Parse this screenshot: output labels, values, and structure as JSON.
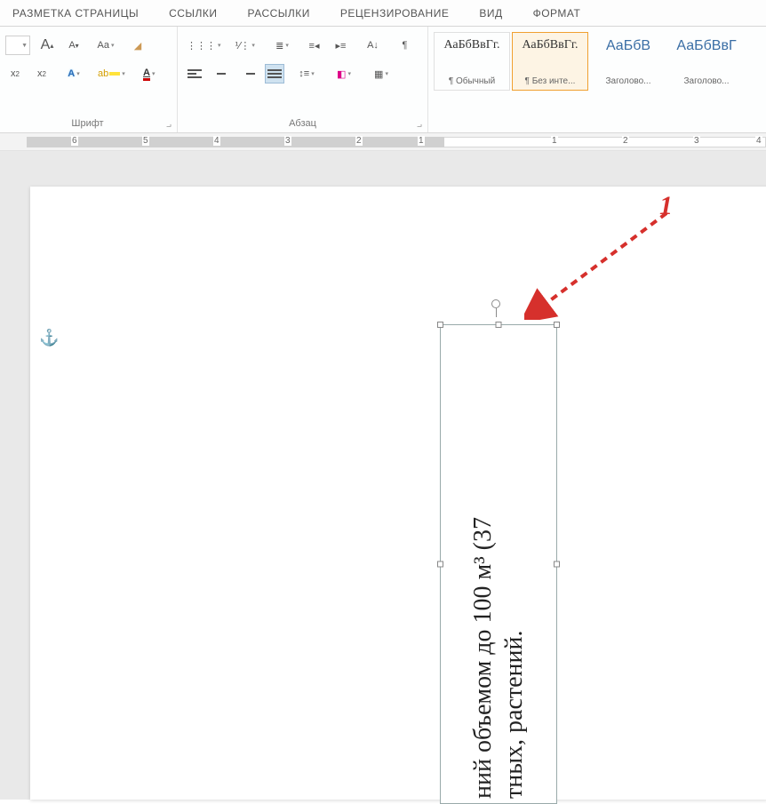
{
  "tabs": {
    "page_layout": "РАЗМЕТКА СТРАНИЦЫ",
    "references": "ССЫЛКИ",
    "mailings": "РАССЫЛКИ",
    "review": "РЕЦЕНЗИРОВАНИЕ",
    "view": "ВИД",
    "format": "ФОРМАТ"
  },
  "ribbon": {
    "font": {
      "label": "Шрифт",
      "grow": "A",
      "shrink": "A",
      "case": "Aa",
      "clear": "⌫",
      "sub": "x",
      "sup": "x",
      "text_effects": "A",
      "highlight": "✎",
      "font_color": "A"
    },
    "paragraph": {
      "label": "Абзац"
    },
    "styles": {
      "preview_text": "АаБбВвГг.",
      "preview_text2": "АаБбВ",
      "preview_text3": "АаБбВвГ",
      "normal": "¶ Обычный",
      "no_spacing": "¶ Без инте...",
      "heading1": "Заголово...",
      "heading2": "Заголово..."
    }
  },
  "ruler": {
    "numbers": [
      "6",
      "5",
      "4",
      "3",
      "2",
      "1",
      "",
      "1",
      "2",
      "3",
      "4"
    ]
  },
  "document": {
    "textbox_line1": "ний объемом до 100 м³ (37",
    "textbox_line2": "тных, растений."
  },
  "annotation": {
    "number": "1"
  }
}
